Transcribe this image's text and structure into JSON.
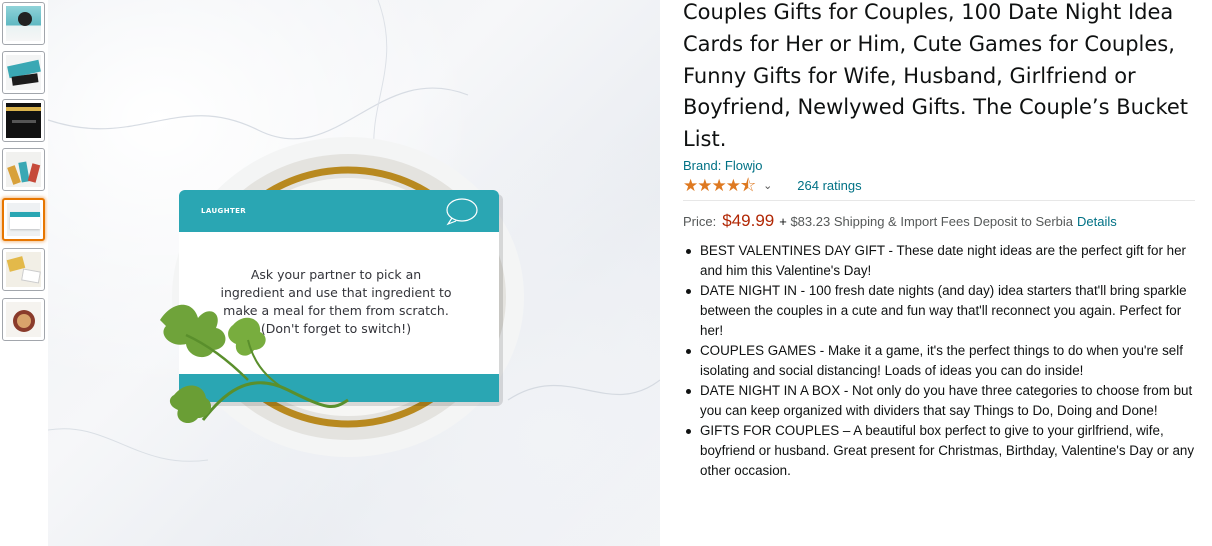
{
  "thumbnails": [
    {
      "name": "thumbnail-1",
      "active": false
    },
    {
      "name": "thumbnail-2",
      "active": false
    },
    {
      "name": "thumbnail-3",
      "active": false
    },
    {
      "name": "thumbnail-4",
      "active": false
    },
    {
      "name": "thumbnail-5",
      "active": true
    },
    {
      "name": "thumbnail-6",
      "active": false
    },
    {
      "name": "thumbnail-7",
      "active": false
    }
  ],
  "main_image": {
    "card_category": "LAUGHTER",
    "card_text": "Ask your partner to pick an ingredient and use that ingredient to make a meal for them from scratch. (Don't forget to switch!)"
  },
  "product": {
    "title": "Couples Gifts for Couples, 100 Date Night Idea Cards for Her or Him, Cute Games for Couples, Funny Gifts for Wife, Husband, Girlfriend or Boyfriend, Newlywed Gifts. The Couple’s Bucket List.",
    "brand": "Brand: Flowjo",
    "rating_stars": "★★★★⯪",
    "rating_value": 4.5,
    "ratings_count": "264 ratings",
    "price_label": "Price:",
    "price": "$49.99",
    "shipping_prefix": "+",
    "shipping_amount": "$83.23",
    "shipping_text": "Shipping & Import Fees Deposit to Serbia",
    "details_link": "Details",
    "bullets": [
      "BEST VALENTINES DAY GIFT - These date night ideas are the perfect gift for her and him this Valentine's Day!",
      "DATE NIGHT IN - 100 fresh date nights (and day) idea starters that'll bring sparkle between the couples in a cute and fun way that'll reconnect you again. Perfect for her!",
      "COUPLES GAMES - Make it a game, it's the perfect things to do when you're self isolating and social distancing! Loads of ideas you can do inside!",
      "DATE NIGHT IN A BOX - Not only do you have three categories to choose from but you can keep organized with dividers that say Things to Do, Doing and Done!",
      "GIFTS FOR COUPLES – A beautiful box perfect to give to your girlfriend, wife, boyfriend or husband. Great present for Christmas, Birthday, Valentine's Day or any other occasion."
    ]
  },
  "colors": {
    "link": "#007185",
    "price": "#b12704",
    "stars": "#de7921",
    "card_teal": "#2aa6b3",
    "thumb_active_border": "#e77600"
  }
}
